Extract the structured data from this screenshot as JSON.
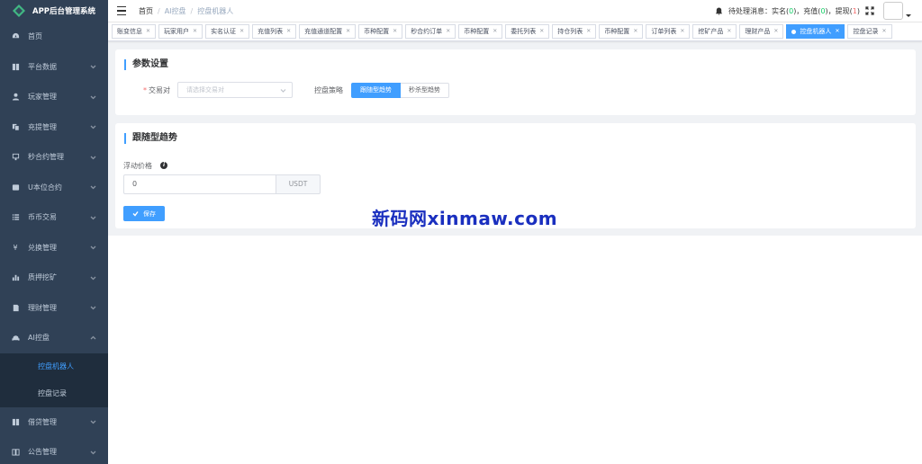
{
  "app": {
    "title": "APP后台管理系统"
  },
  "sidebar": {
    "items": [
      {
        "label": "首页",
        "icon": "dashboard-icon"
      },
      {
        "label": "平台数据",
        "icon": "book-icon"
      },
      {
        "label": "玩家管理",
        "icon": "user-icon"
      },
      {
        "label": "充提管理",
        "icon": "copy-icon"
      },
      {
        "label": "秒合约管理",
        "icon": "monitor-icon"
      },
      {
        "label": "U本位合约",
        "icon": "wallet-icon"
      },
      {
        "label": "币币交易",
        "icon": "list-icon"
      },
      {
        "label": "兑换管理",
        "icon": "yen-icon"
      },
      {
        "label": "质押挖矿",
        "icon": "bar-chart-icon"
      },
      {
        "label": "理财管理",
        "icon": "document-icon"
      },
      {
        "label": "AI控盘",
        "icon": "robot-icon"
      }
    ],
    "submenu": [
      {
        "label": "控盘机器人"
      },
      {
        "label": "控盘记录"
      }
    ],
    "bottom_items": [
      {
        "label": "借贷管理",
        "icon": "book-icon"
      },
      {
        "label": "公告管理",
        "icon": "open-book-icon"
      }
    ]
  },
  "breadcrumb": [
    "首页",
    "AI控盘",
    "控盘机器人"
  ],
  "header": {
    "pending_prefix": "待处理消息：实名(",
    "realname_count": "0",
    "mid1": ")，充值(",
    "recharge_count": "0",
    "mid2": ")，提现(",
    "withdraw_count": "1",
    "suffix": ")"
  },
  "tags": [
    "账变信息",
    "玩家用户",
    "实名认证",
    "充值列表",
    "充值通道配置",
    "币种配置",
    "秒合约订单",
    "币种配置",
    "委托列表",
    "持仓列表",
    "币种配置",
    "订单列表",
    "挖矿产品",
    "理财产品",
    "控盘机器人",
    "控盘记录"
  ],
  "active_tag_index": 14,
  "params_card": {
    "title": "参数设置",
    "pair_label": "交易对",
    "pair_placeholder": "请选择交易对",
    "strategy_label": "控盘策略",
    "strategy_options": [
      "跟随型趋势",
      "秒杀型趋势"
    ],
    "strategy_selected": "跟随型趋势"
  },
  "follow_card": {
    "title": "跟随型趋势",
    "float_label": "浮动价格",
    "float_value": "0",
    "unit": "USDT",
    "save_label": "保存"
  },
  "watermark": "新码网xinmaw.com",
  "colors": {
    "primary": "#409eff",
    "sidebar_bg": "#304156",
    "submenu_bg": "#1f2d3d"
  }
}
